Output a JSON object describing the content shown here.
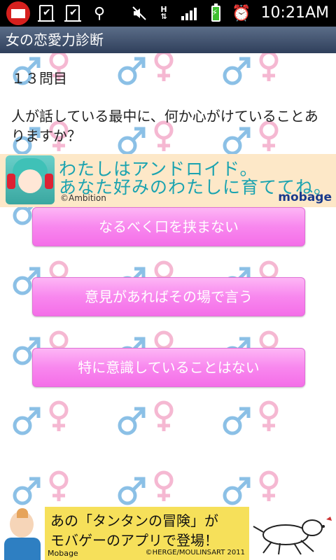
{
  "status_bar": {
    "time": "10:21AM",
    "icons": [
      "gmail-icon",
      "task-done-icon",
      "task-done-icon",
      "usb-icon",
      "mute-icon",
      "data-transfer-icon",
      "signal-icon",
      "battery-charging-icon",
      "alarm-icon"
    ],
    "data_label": "H"
  },
  "app": {
    "title": "女の恋愛力診断"
  },
  "quiz": {
    "number": "１３問目",
    "question": "人が話している最中に、何か心がけていることありますか？",
    "options": [
      "なるべく口を挟まない",
      "意見があればその場で言う",
      "特に意識していることはない"
    ]
  },
  "ad_banner": {
    "line1": "わたしはアンドロイド。",
    "line2": "あなた好みのわたしに育ててね。",
    "credit": "©Ambition",
    "brand": "mobage"
  },
  "bottom_ad": {
    "line1": "あの「タンタンの冒険」が",
    "line2": "モバゲーのアプリで登場！",
    "brand": "Mobage",
    "copyright": "©HERGE/MOULINSART 2011"
  },
  "colors": {
    "male_symbol": "#8bc0e6",
    "female_symbol": "#f5b8d2",
    "button": "#f887ee",
    "title_bar": "#3f4f6b"
  }
}
